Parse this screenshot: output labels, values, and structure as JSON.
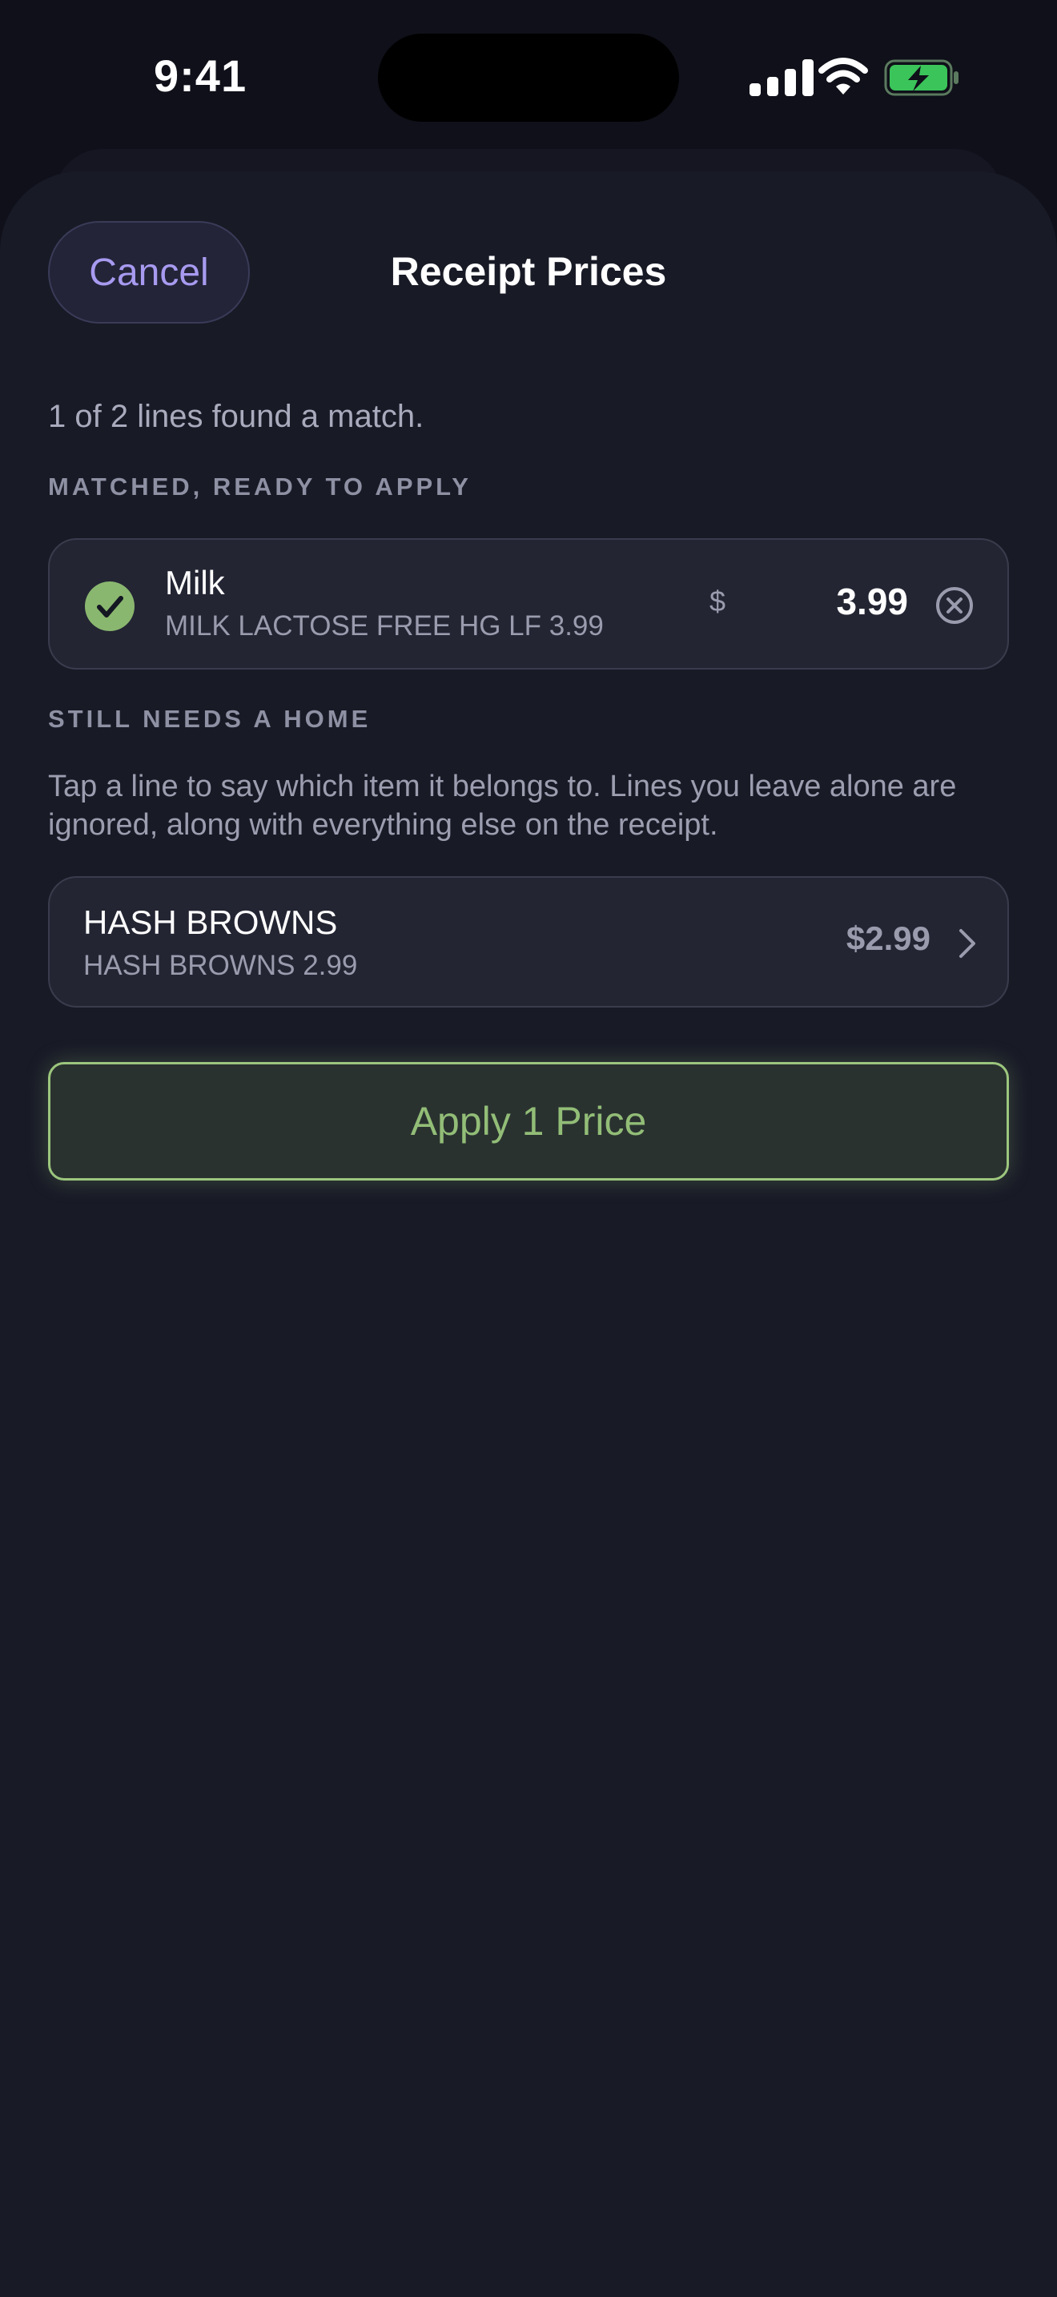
{
  "status_bar": {
    "time": "9:41",
    "icons": [
      "cellular-signal-icon",
      "wifi-icon",
      "battery-charging-icon"
    ],
    "battery_color": "#3bc45a"
  },
  "sheet": {
    "title": "Receipt Prices",
    "cancel_label": "Cancel",
    "summary": "1 of 2 lines found a match."
  },
  "matched": {
    "header": "MATCHED, READY TO APPLY",
    "items": [
      {
        "name": "Milk",
        "receipt_line": "MILK LACTOSE FREE HG LF 3.99",
        "currency": "$",
        "price": "3.99",
        "status_icon": "checkmark-circle-icon",
        "remove_icon": "xmark-circle-icon"
      }
    ]
  },
  "unmatched": {
    "header": "STILL NEEDS A HOME",
    "help_text": "Tap a line to say which item it belongs to. Lines you leave alone are ignored, along with everything else on the receipt.",
    "items": [
      {
        "name": "HASH BROWNS",
        "receipt_line": "HASH BROWNS 2.99",
        "price": "$2.99",
        "icon": "chevron-right-icon"
      }
    ]
  },
  "apply_button": {
    "label": "Apply 1 Price"
  },
  "colors": {
    "background": "#181a26",
    "accent_purple": "#a79af0",
    "accent_green": "#9cc67d",
    "text_secondary": "#9a9cae"
  }
}
